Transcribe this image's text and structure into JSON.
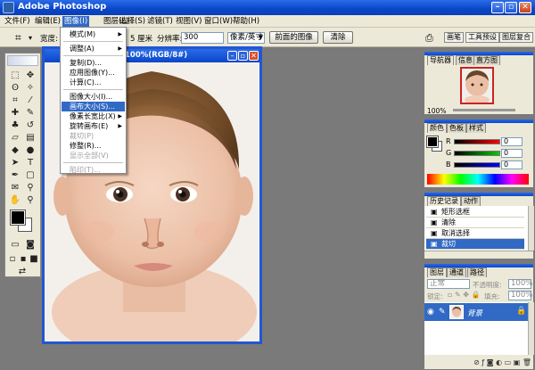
{
  "app": {
    "title": "Adobe Photoshop"
  },
  "menubar": [
    {
      "label": "文件(F)",
      "active": false
    },
    {
      "label": "编辑(E)",
      "active": false
    },
    {
      "label": "图像(I)",
      "active": true
    },
    {
      "label": "图层(L)",
      "active": false
    },
    {
      "label": "选择(S)",
      "active": false
    },
    {
      "label": "滤镜(T)",
      "active": false
    },
    {
      "label": "视图(V)",
      "active": false
    },
    {
      "label": "窗口(W)",
      "active": false
    },
    {
      "label": "帮助(H)",
      "active": false
    }
  ],
  "options": {
    "width_label": "宽度:",
    "cm_value": "5 厘米",
    "resolution_label": "分辨率:",
    "resolution_value": "300",
    "unit_value": "像素/英寸",
    "front_image_button": "前面的图像",
    "clear_button": "清除",
    "tabs": [
      "画笔",
      "工具预设",
      "图层复合"
    ]
  },
  "image_menu": [
    {
      "label": "模式(M)",
      "submenu": true,
      "state": "normal"
    },
    {
      "separator": true
    },
    {
      "label": "调整(A)",
      "submenu": true,
      "state": "normal"
    },
    {
      "separator": true
    },
    {
      "label": "复制(D)...",
      "submenu": false,
      "state": "normal"
    },
    {
      "label": "应用图像(Y)...",
      "submenu": false,
      "state": "normal"
    },
    {
      "label": "计算(C)...",
      "submenu": false,
      "state": "normal"
    },
    {
      "separator": true
    },
    {
      "label": "图像大小(I)...",
      "submenu": false,
      "state": "normal"
    },
    {
      "label": "画布大小(S)...",
      "submenu": false,
      "state": "selected"
    },
    {
      "label": "像素长宽比(X)",
      "submenu": true,
      "state": "normal"
    },
    {
      "label": "旋转画布(E)",
      "submenu": true,
      "state": "normal"
    },
    {
      "label": "裁切(P)",
      "submenu": false,
      "state": "disabled"
    },
    {
      "label": "修整(R)...",
      "submenu": false,
      "state": "normal"
    },
    {
      "label": "显示全部(V)",
      "submenu": false,
      "state": "disabled"
    },
    {
      "separator": true
    },
    {
      "label": "陷印(T)...",
      "submenu": false,
      "state": "disabled"
    }
  ],
  "document": {
    "title": "100%(RGB/8#)"
  },
  "navigator": {
    "tabs": [
      "导航器",
      "信息",
      "直方图"
    ],
    "zoom": "100%"
  },
  "color": {
    "tabs": [
      "颜色",
      "色板",
      "样式"
    ],
    "channels": [
      {
        "label": "R",
        "value": "0",
        "color": "#c00000"
      },
      {
        "label": "G",
        "value": "0",
        "color": "#00a000"
      },
      {
        "label": "B",
        "value": "0",
        "color": "#0000c8"
      }
    ]
  },
  "history": {
    "tabs": [
      "历史记录",
      "动作"
    ],
    "items": [
      {
        "label": "矩形选框",
        "selected": false
      },
      {
        "label": "清除",
        "selected": false
      },
      {
        "label": "取消选择",
        "selected": false
      },
      {
        "label": "裁切",
        "selected": true
      }
    ]
  },
  "layers": {
    "tabs": [
      "图层",
      "通道",
      "路径"
    ],
    "blend_mode": "正常",
    "opacity_label": "不透明度:",
    "opacity_value": "100%",
    "lock_label": "锁定:",
    "fill_label": "填充:",
    "fill_value": "100%",
    "layer_name": "背景"
  }
}
